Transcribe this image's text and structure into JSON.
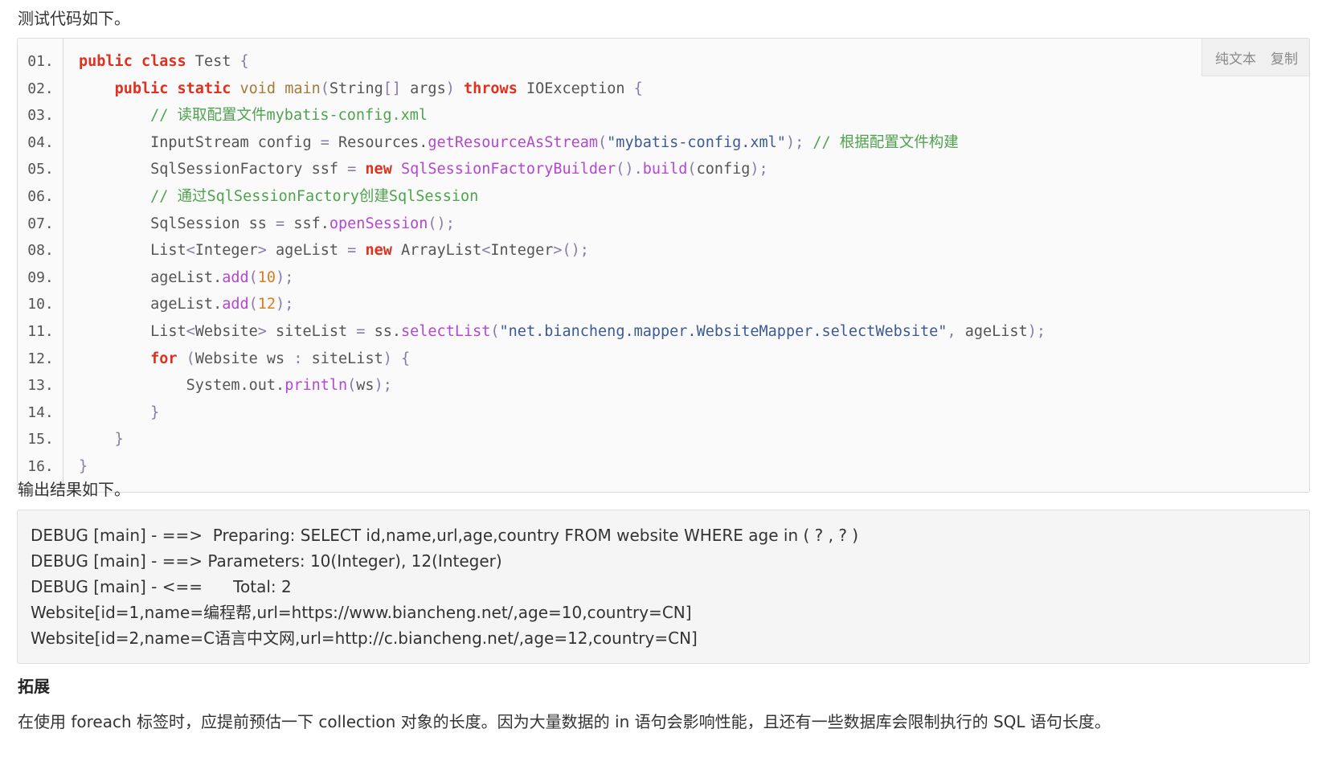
{
  "intro": "测试代码如下。",
  "toolbar": {
    "plain_label": "纯文本",
    "copy_label": "复制"
  },
  "code_lines": [
    {
      "num": "01.",
      "tokens": [
        [
          "kw",
          "public"
        ],
        [
          "plain",
          " "
        ],
        [
          "kw",
          "class"
        ],
        [
          "plain",
          " Test "
        ],
        [
          "pn",
          "{"
        ]
      ]
    },
    {
      "num": "02.",
      "tokens": [
        [
          "plain",
          "    "
        ],
        [
          "kw",
          "public"
        ],
        [
          "plain",
          " "
        ],
        [
          "kw",
          "static"
        ],
        [
          "plain",
          " "
        ],
        [
          "ty",
          "void"
        ],
        [
          "plain",
          " "
        ],
        [
          "ty",
          "main"
        ],
        [
          "pn",
          "("
        ],
        [
          "plain",
          "String"
        ],
        [
          "pn",
          "[]"
        ],
        [
          "plain",
          " args"
        ],
        [
          "pn",
          ")"
        ],
        [
          "plain",
          " "
        ],
        [
          "kw",
          "throws"
        ],
        [
          "plain",
          " IOException "
        ],
        [
          "pn",
          "{"
        ]
      ]
    },
    {
      "num": "03.",
      "tokens": [
        [
          "plain",
          "        "
        ],
        [
          "cm",
          "// 读取配置文件mybatis-config.xml"
        ]
      ]
    },
    {
      "num": "04.",
      "tokens": [
        [
          "plain",
          "        InputStream config "
        ],
        [
          "pn",
          "="
        ],
        [
          "plain",
          " Resources."
        ],
        [
          "fn",
          "getResourceAsStream"
        ],
        [
          "pn",
          "("
        ],
        [
          "st",
          "\"mybatis-config.xml\""
        ],
        [
          "pn",
          ");"
        ],
        [
          "plain",
          " "
        ],
        [
          "cm",
          "// 根据配置文件构建"
        ]
      ]
    },
    {
      "num": "05.",
      "tokens": [
        [
          "plain",
          "        SqlSessionFactory ssf "
        ],
        [
          "pn",
          "="
        ],
        [
          "plain",
          " "
        ],
        [
          "kw",
          "new"
        ],
        [
          "plain",
          " "
        ],
        [
          "fn",
          "SqlSessionFactoryBuilder"
        ],
        [
          "pn",
          "()."
        ],
        [
          "fn",
          "build"
        ],
        [
          "pn",
          "("
        ],
        [
          "plain",
          "config"
        ],
        [
          "pn",
          ");"
        ]
      ]
    },
    {
      "num": "06.",
      "tokens": [
        [
          "plain",
          "        "
        ],
        [
          "cm",
          "// 通过SqlSessionFactory创建SqlSession"
        ]
      ]
    },
    {
      "num": "07.",
      "tokens": [
        [
          "plain",
          "        SqlSession ss "
        ],
        [
          "pn",
          "="
        ],
        [
          "plain",
          " ssf."
        ],
        [
          "fn",
          "openSession"
        ],
        [
          "pn",
          "();"
        ]
      ]
    },
    {
      "num": "08.",
      "tokens": [
        [
          "plain",
          "        List"
        ],
        [
          "pn",
          "<"
        ],
        [
          "plain",
          "Integer"
        ],
        [
          "pn",
          ">"
        ],
        [
          "plain",
          " ageList "
        ],
        [
          "pn",
          "="
        ],
        [
          "plain",
          " "
        ],
        [
          "kw",
          "new"
        ],
        [
          "plain",
          " ArrayList"
        ],
        [
          "pn",
          "<"
        ],
        [
          "plain",
          "Integer"
        ],
        [
          "pn",
          ">();"
        ]
      ]
    },
    {
      "num": "09.",
      "tokens": [
        [
          "plain",
          "        ageList."
        ],
        [
          "fn",
          "add"
        ],
        [
          "pn",
          "("
        ],
        [
          "nm",
          "10"
        ],
        [
          "pn",
          ");"
        ]
      ]
    },
    {
      "num": "10.",
      "tokens": [
        [
          "plain",
          "        ageList."
        ],
        [
          "fn",
          "add"
        ],
        [
          "pn",
          "("
        ],
        [
          "nm",
          "12"
        ],
        [
          "pn",
          ");"
        ]
      ]
    },
    {
      "num": "11.",
      "tokens": [
        [
          "plain",
          "        List"
        ],
        [
          "pn",
          "<"
        ],
        [
          "plain",
          "Website"
        ],
        [
          "pn",
          ">"
        ],
        [
          "plain",
          " siteList "
        ],
        [
          "pn",
          "="
        ],
        [
          "plain",
          " ss."
        ],
        [
          "fn",
          "selectList"
        ],
        [
          "pn",
          "("
        ],
        [
          "st",
          "\"net.biancheng.mapper.WebsiteMapper.selectWebsite\""
        ],
        [
          "pn",
          ","
        ],
        [
          "plain",
          " ageList"
        ],
        [
          "pn",
          ");"
        ]
      ]
    },
    {
      "num": "12.",
      "tokens": [
        [
          "plain",
          "        "
        ],
        [
          "kw",
          "for"
        ],
        [
          "plain",
          " "
        ],
        [
          "pn",
          "("
        ],
        [
          "plain",
          "Website ws "
        ],
        [
          "pn",
          ":"
        ],
        [
          "plain",
          " siteList"
        ],
        [
          "pn",
          ")"
        ],
        [
          "plain",
          " "
        ],
        [
          "pn",
          "{"
        ]
      ]
    },
    {
      "num": "13.",
      "tokens": [
        [
          "plain",
          "            System.out."
        ],
        [
          "fn",
          "println"
        ],
        [
          "pn",
          "("
        ],
        [
          "plain",
          "ws"
        ],
        [
          "pn",
          ");"
        ]
      ]
    },
    {
      "num": "14.",
      "tokens": [
        [
          "plain",
          "        "
        ],
        [
          "pn",
          "}"
        ]
      ]
    },
    {
      "num": "15.",
      "tokens": [
        [
          "plain",
          "    "
        ],
        [
          "pn",
          "}"
        ]
      ]
    },
    {
      "num": "16.",
      "tokens": [
        [
          "pn",
          "}"
        ]
      ]
    }
  ],
  "result_title": "输出结果如下。",
  "output_lines": [
    "DEBUG [main] - ==>  Preparing: SELECT id,name,url,age,country FROM website WHERE age in ( ? , ? )",
    "DEBUG [main] - ==> Parameters: 10(Integer), 12(Integer)",
    "DEBUG [main] - <==      Total: 2",
    "Website[id=1,name=编程帮,url=https://www.biancheng.net/,age=10,country=CN]",
    "Website[id=2,name=C语言中文网,url=http://c.biancheng.net/,age=12,country=CN]"
  ],
  "section_heading": "拓展",
  "body_text": "在使用 foreach 标签时，应提前预估一下 collection 对象的长度。因为大量数据的 in 语句会影响性能，且还有一些数据库会限制执行的 SQL 语句长度。",
  "colors": {
    "keyword": "#e0301e",
    "type": "#a57b32",
    "function": "#b347d1",
    "comment": "#4fa34f",
    "string": "#3c5a96",
    "number": "#e07a1e",
    "punctuation": "#8a7aa8"
  }
}
